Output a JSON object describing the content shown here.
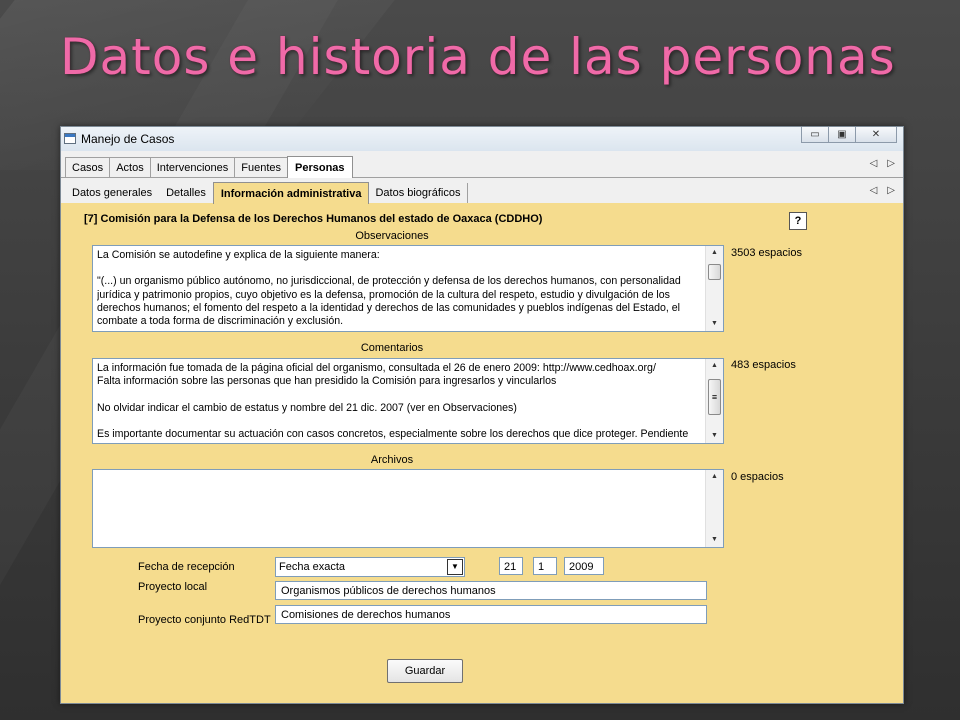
{
  "slide": {
    "title": "Datos e historia de las personas"
  },
  "window": {
    "title": "Manejo de Casos",
    "controls": {
      "minimize": "▭",
      "restore": "▣",
      "close": "✕"
    }
  },
  "tabs_main": [
    "Casos",
    "Actos",
    "Intervenciones",
    "Fuentes",
    "Personas"
  ],
  "tabs_main_active": "Personas",
  "tabs_sub": [
    "Datos generales",
    "Detalles",
    "Información administrativa",
    "Datos biográficos"
  ],
  "tabs_sub_active": "Información administrativa",
  "nav": {
    "prev": "◁",
    "next": "▷"
  },
  "panel": {
    "title": "[7] Comisión para la Defensa de los Derechos Humanos del estado de Oaxaca (CDDHO)",
    "help": "?"
  },
  "observaciones": {
    "label": "Observaciones",
    "text": "La Comisión se autodefine y explica de la siguiente manera:\n\n\"(...) un organismo público autónomo, no jurisdiccional, de protección y defensa de los derechos humanos, con personalidad jurídica y patrimonio propios, cuyo objetivo es la defensa, promoción de la cultura del respeto, estudio y divulgación de los derechos humanos; el fomento del respeto a la identidad y derechos de las comunidades y pueblos indígenas del Estado, el combate a toda forma de discriminación y exclusión.",
    "count": "3503 espacios"
  },
  "comentarios": {
    "label": "Comentarios",
    "text": "La información fue tomada de la página oficial del organismo, consultada el 26 de enero 2009: http://www.cedhoax.org/\nFalta información sobre las personas que han presidido la Comisión para ingresarlos y vincularlos\n\nNo olvidar indicar el cambio de estatus y nombre del 21 dic. 2007 (ver en Observaciones)\n\nEs importante documentar su actuación con casos concretos, especialmente sobre los derechos que dice proteger. Pendiente",
    "count": "483 espacios"
  },
  "archivos": {
    "label": "Archivos",
    "text": "",
    "count": "0 espacios"
  },
  "scrollbar": {
    "up": "▲",
    "down": "▼",
    "grip": "≡"
  },
  "form": {
    "fecha_label": "Fecha de recepción",
    "fecha_tipo": "Fecha exacta",
    "dropdown_arrow": "▼",
    "dia": "21",
    "mes": "1",
    "anio": "2009",
    "proyecto_local_label": "Proyecto local",
    "proyecto_local": "Organismos públicos de derechos humanos",
    "proyecto_conjunto_label": "Proyecto conjunto RedTDT",
    "proyecto_conjunto": "Comisiones de derechos humanos"
  },
  "buttons": {
    "save": "Guardar"
  }
}
